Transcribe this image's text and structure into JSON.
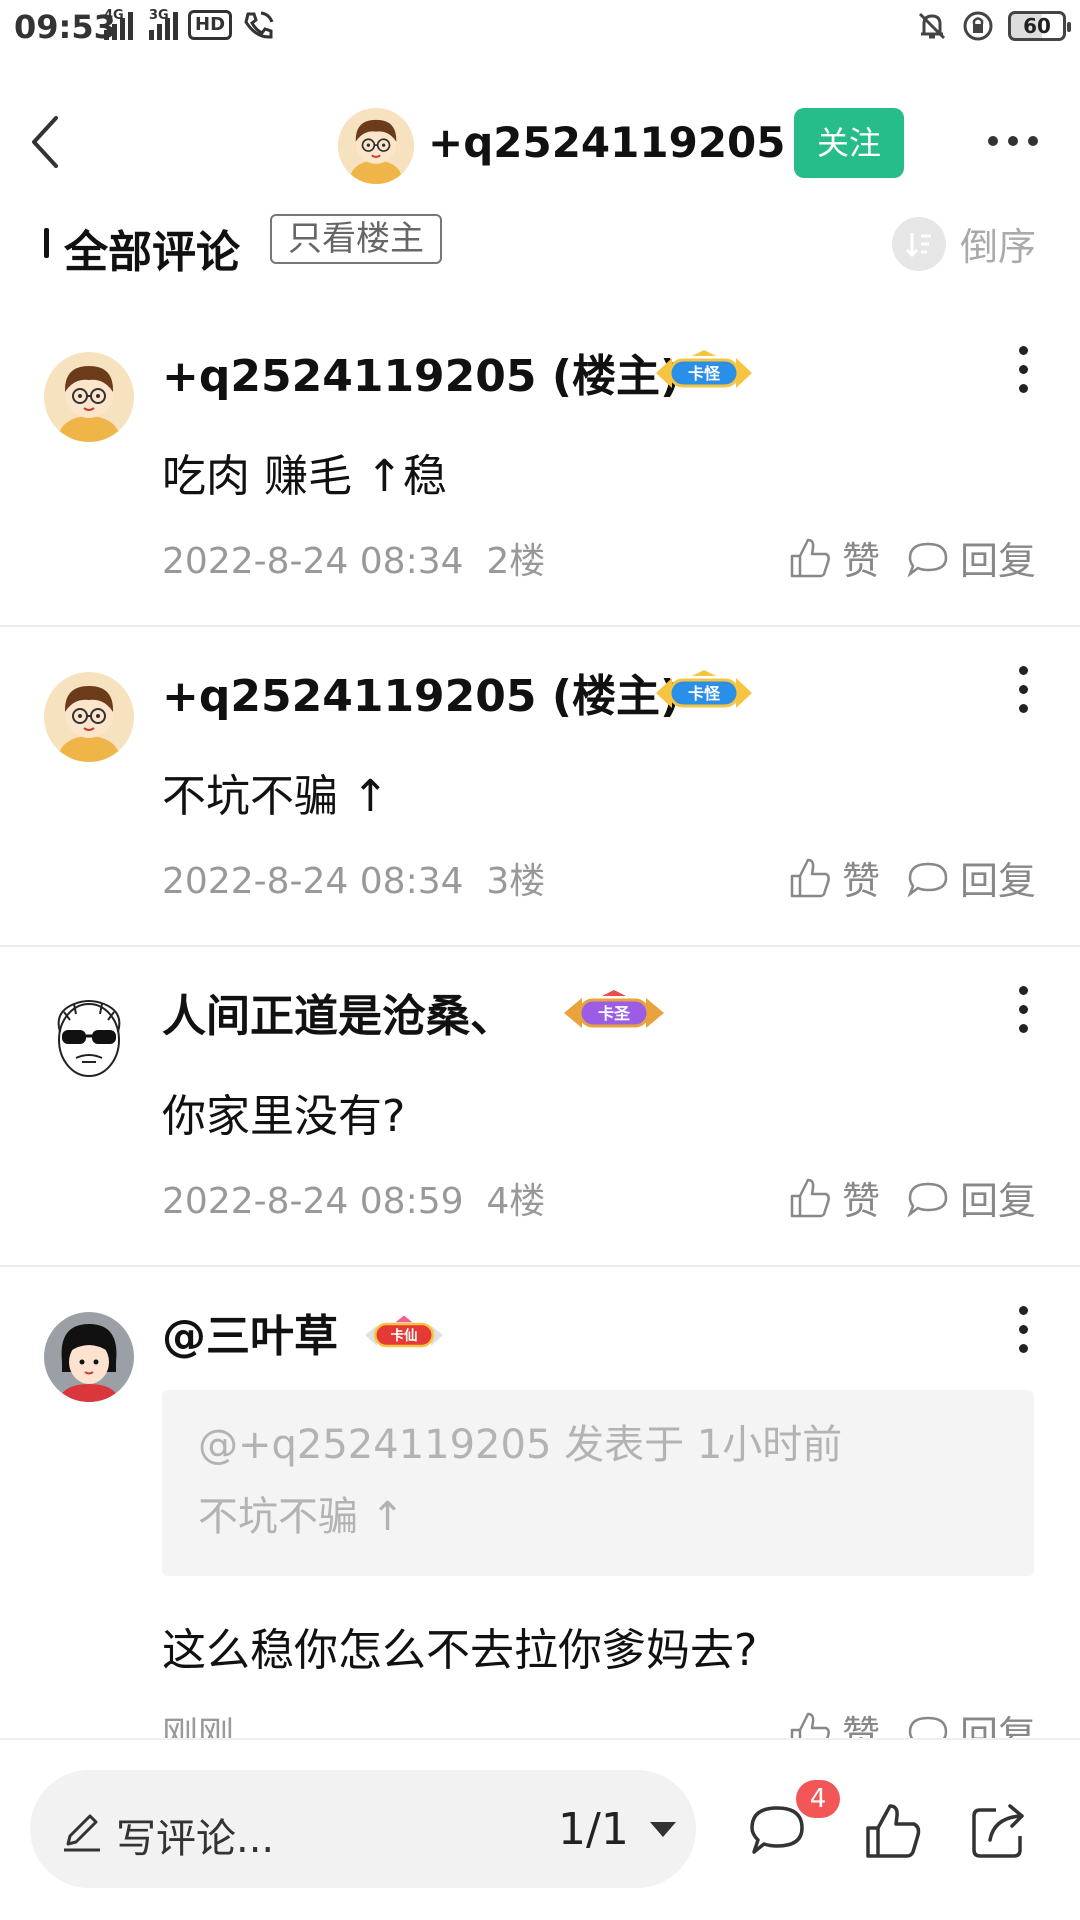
{
  "status_bar": {
    "time": "09:53",
    "net1": "4G",
    "net2": "3G",
    "hd": "HD",
    "battery": "60"
  },
  "header": {
    "username": "+q2524119205",
    "follow_label": "关注"
  },
  "filter": {
    "title": "全部评论",
    "only_op_label": "只看楼主",
    "sort_label": "倒序"
  },
  "comments": [
    {
      "name": "+q2524119205 (楼主)",
      "badge": "卡怪",
      "text": "吃肉 赚毛 ↑稳",
      "time": "2022-8-24 08:34",
      "floor": "2楼",
      "like_label": "赞",
      "reply_label": "回复"
    },
    {
      "name": "+q2524119205 (楼主)",
      "badge": "卡怪",
      "text": "不坑不骗 ↑",
      "time": "2022-8-24 08:34",
      "floor": "3楼",
      "like_label": "赞",
      "reply_label": "回复"
    },
    {
      "name": "人间正道是沧桑、",
      "badge": "卡圣",
      "text": "你家里没有?",
      "time": "2022-8-24 08:59",
      "floor": "4楼",
      "like_label": "赞",
      "reply_label": "回复"
    },
    {
      "name": "@三叶草",
      "badge": "卡仙",
      "quote_head": "@+q2524119205 发表于 1小时前",
      "quote_text": "不坑不骗 ↑",
      "text": "这么稳你怎么不去拉你爹妈去?",
      "time": "刚刚",
      "like_label": "赞",
      "reply_label": "回复"
    }
  ],
  "bottom_bar": {
    "input_placeholder": "写评论...",
    "page": "1/1",
    "comment_count": "4"
  },
  "colors": {
    "accent_green": "#27bd8a",
    "badge_red": "#f25656",
    "muted_text": "#999999"
  },
  "icons": [
    "back-icon",
    "more-icon",
    "sort-icon",
    "like-icon",
    "reply-icon",
    "pencil-icon",
    "comment-icon",
    "thumb-icon",
    "share-icon"
  ]
}
